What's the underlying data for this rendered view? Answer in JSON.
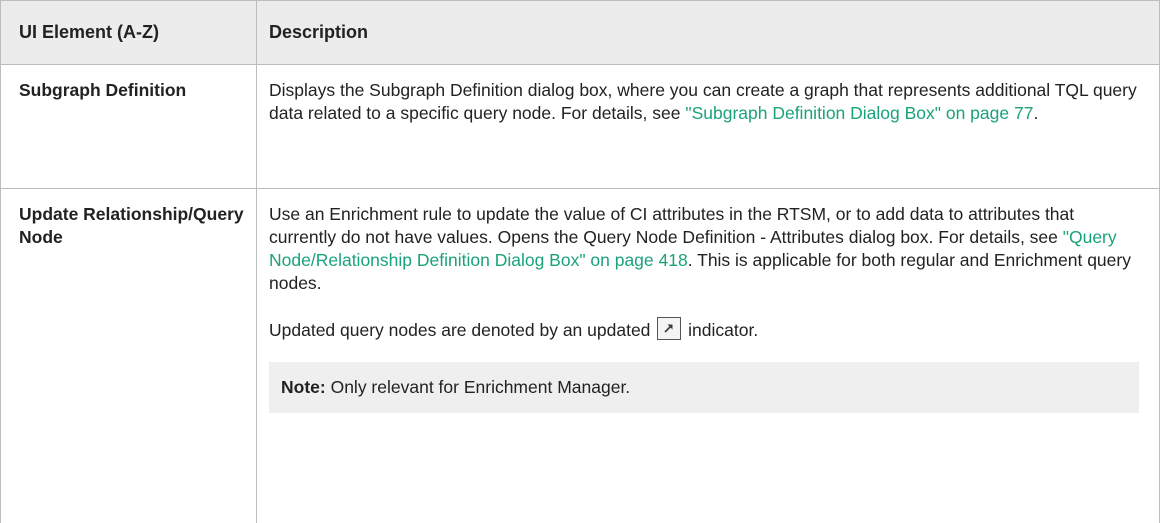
{
  "table": {
    "headers": [
      "UI Element (A-Z)",
      "Description"
    ],
    "rows": [
      {
        "element": "Subgraph Definition",
        "desc_pre": "Displays the Subgraph Definition dialog box, where you can create a graph that represents additional TQL query data related to a specific query node. For details, see ",
        "desc_link": "\"Subgraph Definition Dialog Box\" on page 77",
        "desc_post": "."
      },
      {
        "element": "Update Relationship/Query Node",
        "desc_pre": "Use an Enrichment rule to update the value of CI attributes in the RTSM, or to add data to attributes that currently do not have values. Opens the Query Node Definition - Attributes dialog box. For details, see ",
        "desc_link": "\"Query Node/Relationship Definition Dialog Box\" on page 418",
        "desc_post": ". This is applicable for both regular and Enrichment query nodes.",
        "para2_pre": "Updated query nodes are denoted by an updated ",
        "para2_icon": "updated-indicator-icon",
        "para2_post": " indicator.",
        "note_label": "Note:",
        "note_text": " Only relevant for Enrichment Manager."
      }
    ]
  },
  "colors": {
    "link": "#1aa37a",
    "header_bg": "#ececec",
    "note_bg": "#efefef"
  }
}
